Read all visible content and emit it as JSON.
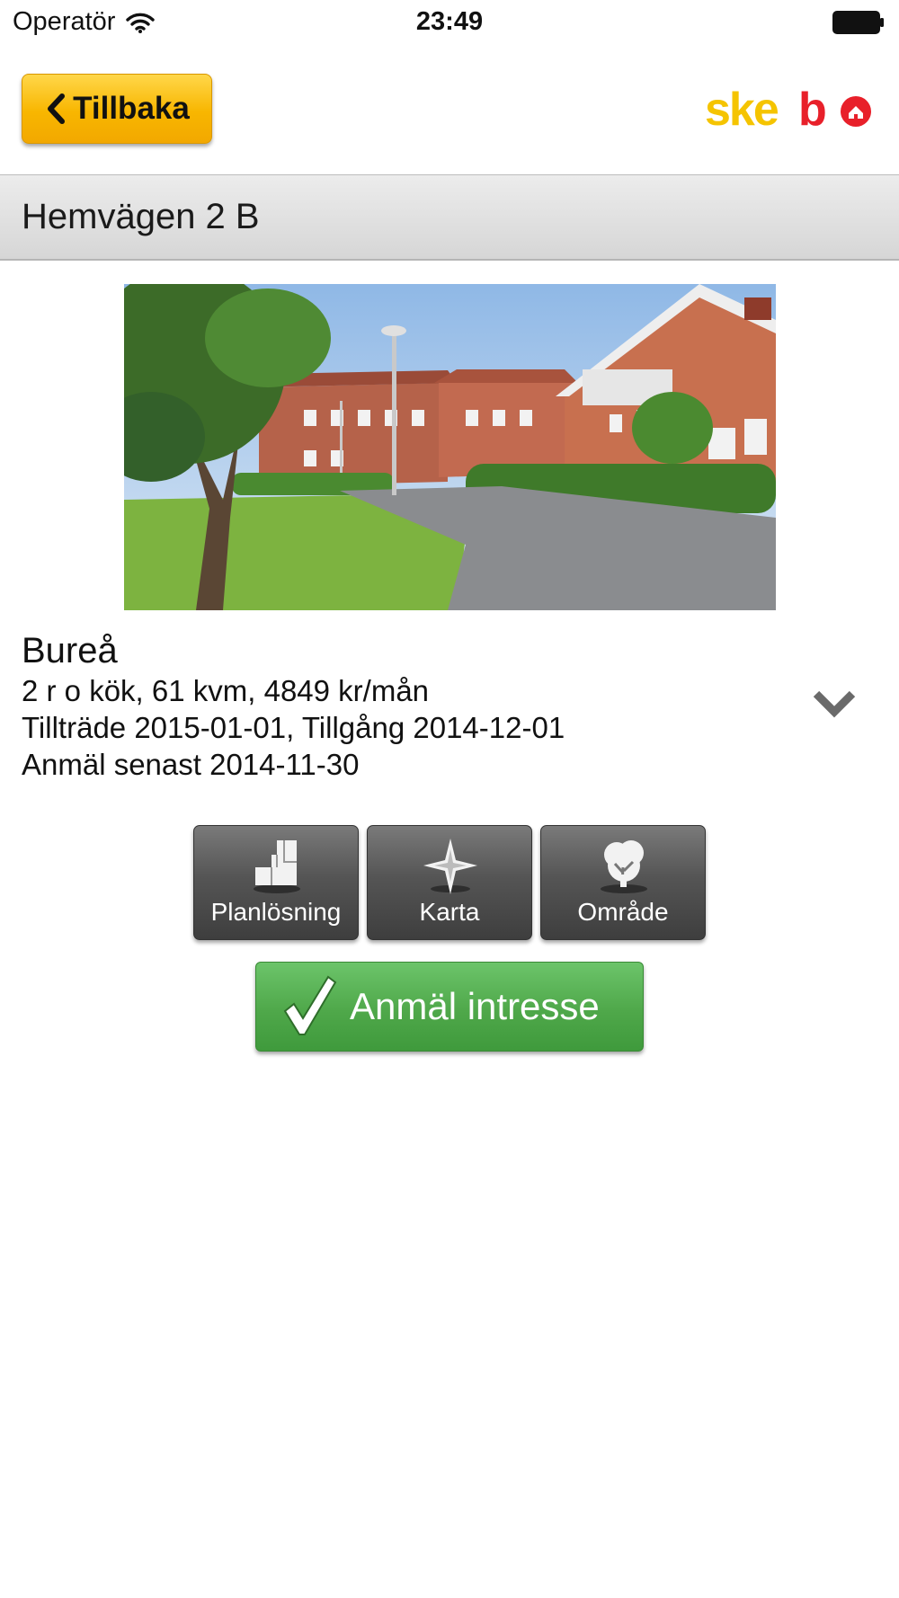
{
  "status_bar": {
    "carrier": "Operatör",
    "time": "23:49",
    "icons": [
      "wifi-icon",
      "battery-icon"
    ]
  },
  "header": {
    "back_label": "Tillbaka",
    "back_icon": "chevron-left-icon",
    "logo_text": "skebo",
    "logo_colors": {
      "ske": "#f5c400",
      "bo": "#e8202a"
    }
  },
  "title_bar": {
    "title": "Hemvägen 2 B"
  },
  "listing": {
    "photo": "building-photo",
    "city": "Bureå",
    "info_line_1": "2 r o kök, 61 kvm, 4849 kr/mån",
    "info_line_2": "Tillträde 2015-01-01, Tillgång 2014-12-01",
    "info_line_3": "Anmäl senast 2014-11-30",
    "expand_icon": "chevron-down-icon"
  },
  "actions": [
    {
      "label": "Planlösning",
      "icon": "floorplan-icon"
    },
    {
      "label": "Karta",
      "icon": "compass-icon"
    },
    {
      "label": "Område",
      "icon": "tree-icon"
    }
  ],
  "interest_button": {
    "label": "Anmäl intresse",
    "icon": "checkmark-icon",
    "color": "#4fa84a"
  },
  "colors": {
    "accent_yellow": "#f8b600",
    "title_bar_gray": "#d6d6d6",
    "action_button_gray": "#555555"
  }
}
